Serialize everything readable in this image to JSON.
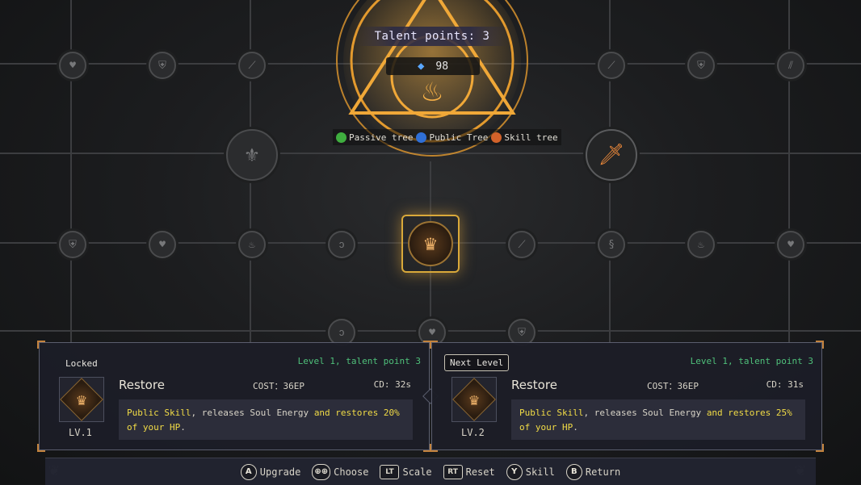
{
  "header": {
    "talent_points_label": "Talent points: 3",
    "currency_amount": "98",
    "currency_icon": "blue-crystal-icon"
  },
  "legend": [
    {
      "label": "Passive tree",
      "color": "#3fae3f"
    },
    {
      "label": "Public Tree",
      "color": "#2f6fd6"
    },
    {
      "label": "Skill tree",
      "color": "#d2622a"
    }
  ],
  "tree": {
    "selected_node_icon": "flame-crown-icon",
    "node_icons": [
      "heart-icon",
      "shield-icon",
      "sword-icon",
      "gauntlet-icon",
      "claw-icon",
      "wing-icon"
    ]
  },
  "current": {
    "state": "Locked",
    "level_info": "Level 1, talent point 3",
    "name": "Restore",
    "cost": "COST：36EP",
    "cd": "CD: 32s",
    "level": "LV.1",
    "desc": {
      "p1": "Public Skill",
      "p2": ", releases Soul Energy ",
      "p3": "and restores 20% of your HP",
      "p4": "."
    }
  },
  "next": {
    "state": "Next Level",
    "level_info": "Level 1, talent point 3",
    "name": "Restore",
    "cost": "COST：36EP",
    "cd": "CD: 31s",
    "level": "LV.2",
    "desc": {
      "p1": "Public Skill",
      "p2": ", releases Soul Energy ",
      "p3": "and restores 25% of your HP",
      "p4": "."
    }
  },
  "controls": [
    {
      "button": "A",
      "label": "Upgrade"
    },
    {
      "button": "⊕⊕",
      "label": "Choose"
    },
    {
      "button": "LT",
      "label": "Scale"
    },
    {
      "button": "RT",
      "label": "Reset"
    },
    {
      "button": "Y",
      "label": "Skill"
    },
    {
      "button": "B",
      "label": "Return"
    }
  ],
  "colors": {
    "accent_gold": "#d9a93a",
    "highlight_yellow": "#f2dc46",
    "level_green": "#4fc07a"
  }
}
